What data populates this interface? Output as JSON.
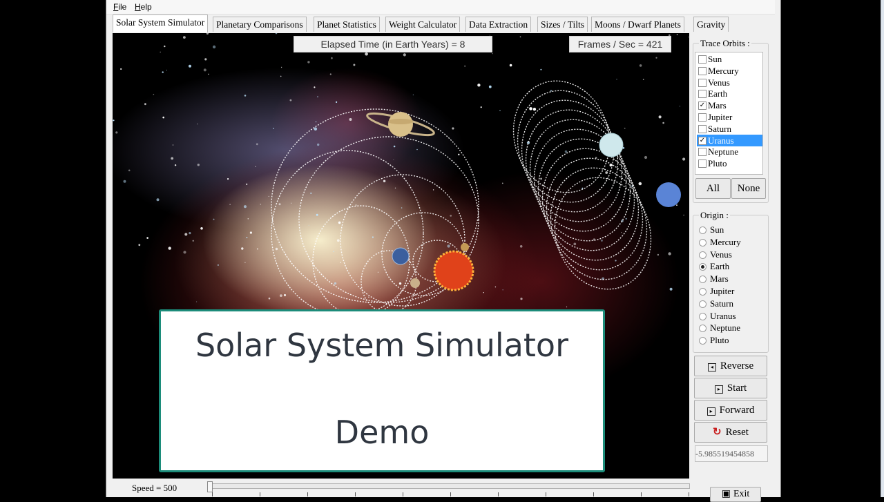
{
  "menu": {
    "file": "File",
    "help": "Help"
  },
  "tabs": [
    "Solar System Simulator",
    "Planetary Comparisons",
    "Planet Statistics",
    "Weight Calculator",
    "Data Extraction",
    "Sizes / Tilts",
    "Moons / Dwarf Planets",
    "Gravity"
  ],
  "active_tab": "Solar System Simulator",
  "hud": {
    "elapsed": "Elapsed Time (in Earth Years) = 8",
    "fps": "Frames / Sec = 421"
  },
  "overlay": {
    "line1": "Solar System Simulator",
    "line2": "Demo"
  },
  "speed": {
    "label": "Speed = 500"
  },
  "trace_orbits": {
    "label": "Trace Orbits :",
    "items": [
      {
        "name": "Sun",
        "checked": false
      },
      {
        "name": "Mercury",
        "checked": false
      },
      {
        "name": "Venus",
        "checked": false
      },
      {
        "name": "Earth",
        "checked": false
      },
      {
        "name": "Mars",
        "checked": true
      },
      {
        "name": "Jupiter",
        "checked": false
      },
      {
        "name": "Saturn",
        "checked": false
      },
      {
        "name": "Uranus",
        "checked": true,
        "selected": true
      },
      {
        "name": "Neptune",
        "checked": false
      },
      {
        "name": "Pluto",
        "checked": false
      }
    ],
    "all_label": "All",
    "none_label": "None"
  },
  "origin": {
    "label": "Origin :",
    "items": [
      "Sun",
      "Mercury",
      "Venus",
      "Earth",
      "Mars",
      "Jupiter",
      "Saturn",
      "Uranus",
      "Neptune",
      "Pluto"
    ],
    "selected": "Earth"
  },
  "controls": {
    "reverse": "Reverse",
    "start": "Start",
    "forward": "Forward",
    "reset": "Reset",
    "exit": "Exit"
  },
  "coord_value": "-5.985519454858",
  "colors": {
    "selection": "#3399ff",
    "card_border": "#1c8c7a",
    "orbit_trace": "#ffffff"
  }
}
